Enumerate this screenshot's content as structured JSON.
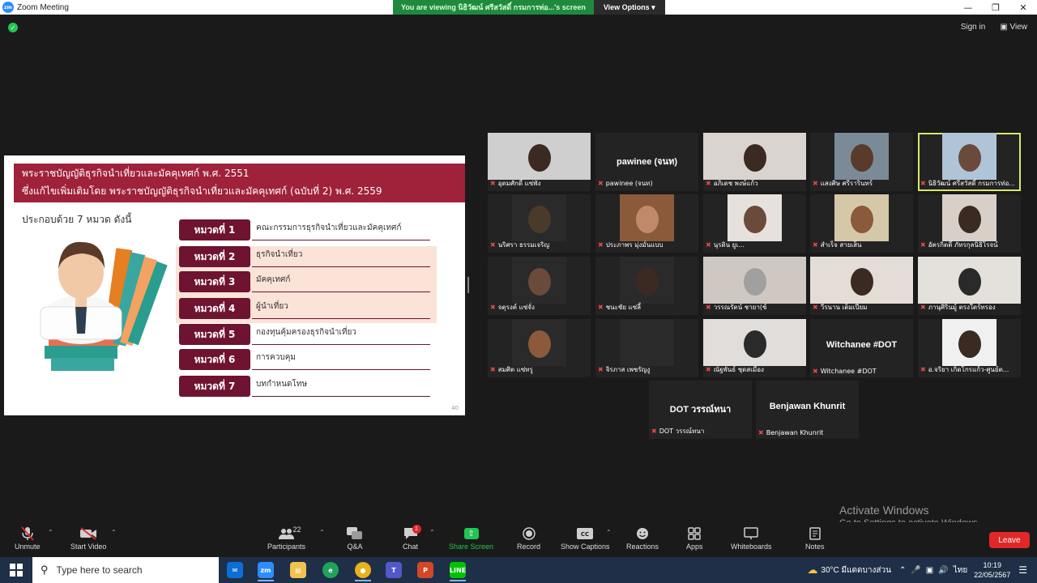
{
  "window": {
    "title": "Zoom Meeting"
  },
  "share_banner": {
    "text": "You are viewing นิธิวัฒน์ ศรีสวัสดิ์ กรมการท่อ...'s screen",
    "view_options": "View Options"
  },
  "top_right": {
    "sign_in": "Sign in",
    "view": "View"
  },
  "slide": {
    "header_line1": "พระราชบัญญัติธุรกิจนำเที่ยวและมัคคุเทศก์ พ.ศ. 2551",
    "header_line2": "ซึ่งแก้ไขเพิ่มเติมโดย พระราชบัญญัติธุรกิจนำเที่ยวและมัคคุเทศก์ (ฉบับที่ 2) พ.ศ. 2559",
    "subtitle": "ประกอบด้วย 7 หมวด ดังนี้",
    "chapters": [
      {
        "label": "หมวดที่ 1",
        "desc": "คณะกรรมการธุรกิจนำเที่ยวและมัคคุเทศก์"
      },
      {
        "label": "หมวดที่ 2",
        "desc": "ธุรกิจนำเที่ยว"
      },
      {
        "label": "หมวดที่ 3",
        "desc": "มัคคุเทศก์"
      },
      {
        "label": "หมวดที่ 4",
        "desc": "ผู้นำเที่ยว"
      },
      {
        "label": "หมวดที่ 5",
        "desc": "กองทุนคุ้มครองธุรกิจนำเที่ยว"
      },
      {
        "label": "หมวดที่ 6",
        "desc": "การควบคุม"
      },
      {
        "label": "หมวดที่ 7",
        "desc": "บทกำหนดโทษ"
      }
    ],
    "page_number": "40"
  },
  "participants": [
    {
      "name": "อุดมศักดิ์ แซ่พัง"
    },
    {
      "name": "pawinee (จนท)",
      "display": "pawinee (จนท)"
    },
    {
      "name": "อภิเดช พงษ์แก้ว"
    },
    {
      "name": "แสงศิษ ศรีรารินทร์"
    },
    {
      "name": "นิธิวัฒน์ ศรีสวัสดิ์ กรมการท่อ..."
    },
    {
      "name": "นริศรา ธรรมเจริญ"
    },
    {
      "name": "ประภาพร มุ่งมั่นแบบ"
    },
    {
      "name": "นุรดิน ยูเ..."
    },
    {
      "name": "สำเร็จ สายเส็น"
    },
    {
      "name": "อัครกิตติ์ ภัทรกุลนิธิโรจน์"
    },
    {
      "name": "จตุรงค์ แซ่จั่ง"
    },
    {
      "name": "ชนะชัย แซ่ลี้"
    },
    {
      "name": "วรรณรัตน์ ชายา(ช์"
    },
    {
      "name": "วีรนาน เต็มเปี่ยม"
    },
    {
      "name": "ภานุศิรินมู์ ตรงใตร์ทรอง"
    },
    {
      "name": "สมศิต แซ่ทรู"
    },
    {
      "name": "จิรภาส เพชรัญงู"
    },
    {
      "name": "ณัฐพันธ์ ชุดสเมือง"
    },
    {
      "name": "Witchanee #DOT",
      "display": "Witchanee #DOT"
    },
    {
      "name": "อ.จริยา เกิดโกรแก้ว-ศูนย์ต..."
    },
    {
      "name": "DOT วรรณ์ทนา",
      "display": "DOT วรรณ์ทนา"
    },
    {
      "name": "Benjawan Khunrit",
      "display": "Benjawan Khunrit"
    }
  ],
  "activate_windows": {
    "line1": "Activate Windows",
    "line2": "Go to Settings to activate Windows."
  },
  "toolbar": {
    "unmute": "Unmute",
    "start_video": "Start Video",
    "participants": "Participants",
    "participants_count": "22",
    "qa": "Q&A",
    "chat": "Chat",
    "chat_badge": "1",
    "share_screen": "Share Screen",
    "record": "Record",
    "show_captions": "Show Captions",
    "reactions": "Reactions",
    "apps": "Apps",
    "whiteboards": "Whiteboards",
    "notes": "Notes",
    "leave": "Leave"
  },
  "taskbar": {
    "search_placeholder": "Type here to search",
    "weather": "30°C  มีแดดบางส่วน",
    "lang": "ไทย",
    "time": "10:19",
    "date": "22/05/2567"
  }
}
